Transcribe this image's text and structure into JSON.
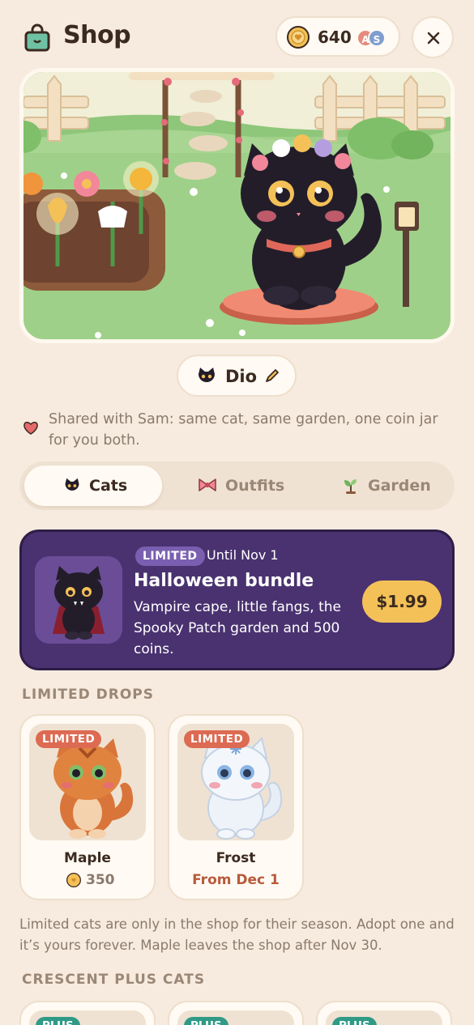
{
  "header": {
    "title": "Shop",
    "coins": "640",
    "avatars": [
      "A",
      "S"
    ]
  },
  "pet": {
    "name": "Dio"
  },
  "shared": {
    "text": "Shared with Sam: same cat, same garden, one coin jar for you both."
  },
  "tabs": [
    {
      "label": "Cats",
      "active": true
    },
    {
      "label": "Outfits",
      "active": false
    },
    {
      "label": "Garden",
      "active": false
    }
  ],
  "promo": {
    "badge": "LIMITED",
    "until": "Until Nov 1",
    "title": "Halloween bundle",
    "description": "Vampire cape, little fangs, the Spooky Patch garden and 500 coins.",
    "price": "$1.99"
  },
  "limited_section": {
    "heading": "LIMITED DROPS",
    "cards": [
      {
        "badge": "LIMITED",
        "name": "Maple",
        "price": "350"
      },
      {
        "badge": "LIMITED",
        "name": "Frost",
        "availability": "From Dec 1"
      }
    ],
    "note": "Limited cats are only in the shop for their season. Adopt one and it’s yours forever. Maple leaves the shop after Nov 30."
  },
  "plus_section": {
    "heading": "CRESCENT PLUS CATS",
    "badges": [
      "PLUS",
      "PLUS",
      "PLUS"
    ]
  },
  "colors": {
    "background": "#f7ebdf",
    "promo": "#4a3270",
    "price_button": "#f4c158",
    "limited_chip": "#dd6a52",
    "plus_chip": "#2f9a86"
  }
}
